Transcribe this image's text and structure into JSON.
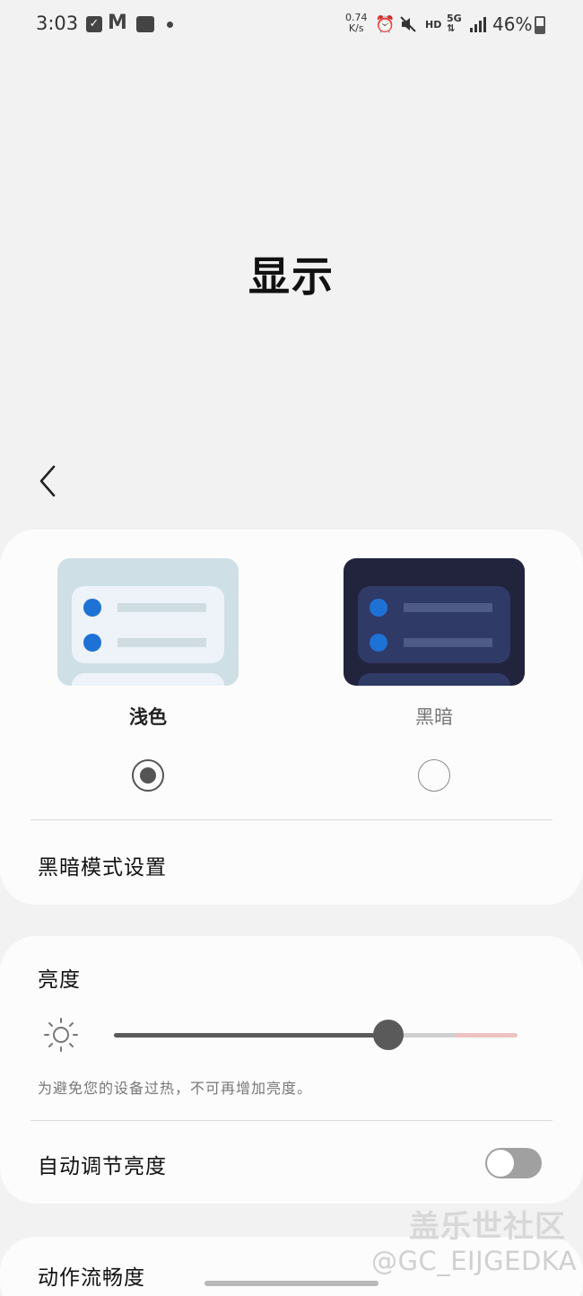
{
  "status_bar": {
    "time": "3:03",
    "network_speed_value": "0.74",
    "network_speed_unit": "K/s",
    "hd_label": "HD",
    "network_type": "5G",
    "battery_percent": "46%",
    "battery_level": 0.46
  },
  "header": {
    "title": "显示",
    "back_icon": "chevron-left-icon"
  },
  "theme_card": {
    "options": [
      {
        "label": "浅色",
        "selected": true
      },
      {
        "label": "黑暗",
        "selected": false
      }
    ],
    "dark_mode_settings_label": "黑暗模式设置"
  },
  "brightness_card": {
    "title": "亮度",
    "icon": "sun-icon",
    "level": 0.68,
    "max_allowed": 0.845,
    "note": "为避免您的设备过热，不可再增加亮度。",
    "adaptive_label": "自动调节亮度",
    "adaptive_enabled": false
  },
  "motion_card": {
    "label": "动作流畅度"
  },
  "watermark": {
    "line1": "盖乐世社区",
    "line2": "@GC_EIJGEDKA"
  },
  "colors": {
    "background": "#f2f2f2",
    "card": "#fcfcfc",
    "accent_blue": "#1e72d6",
    "dark_theme_bg": "#22233d",
    "light_theme_bg": "#cfdfe6"
  }
}
